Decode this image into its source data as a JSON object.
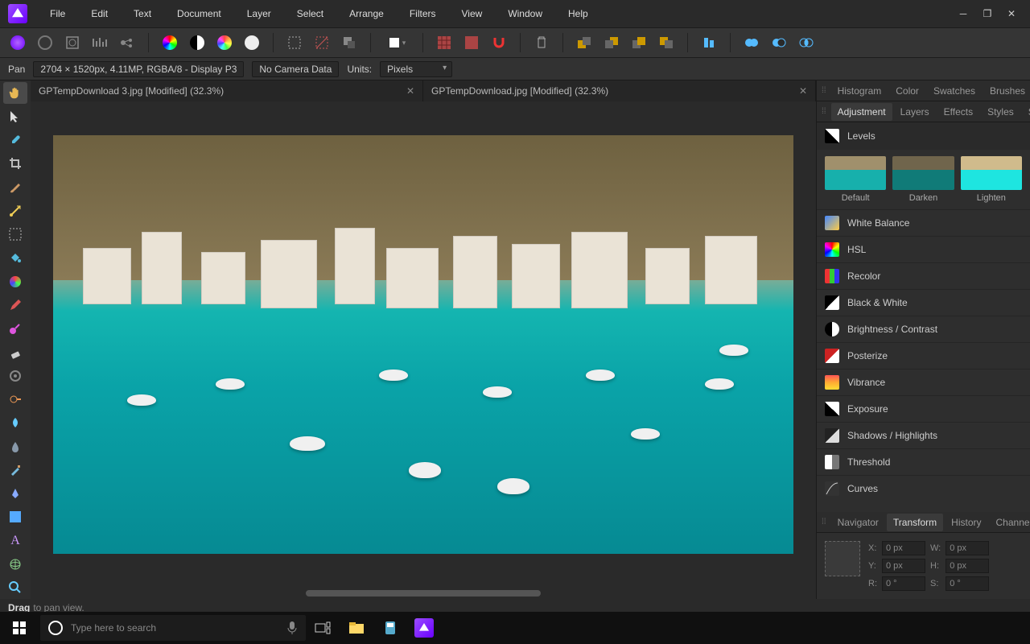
{
  "menu": {
    "items": [
      "File",
      "Edit",
      "Text",
      "Document",
      "Layer",
      "Select",
      "Arrange",
      "Filters",
      "View",
      "Window",
      "Help"
    ]
  },
  "context": {
    "tool": "Pan",
    "info": "2704 × 1520px, 4.11MP, RGBA/8 - Display P3",
    "camera": "No Camera Data",
    "units_label": "Units:",
    "units_value": "Pixels"
  },
  "tabs": [
    {
      "label": "GPTempDownload 3.jpg [Modified] (32.3%)"
    },
    {
      "label": "GPTempDownload.jpg [Modified] (32.3%)"
    }
  ],
  "panel_tabs_top": [
    "Histogram",
    "Color",
    "Swatches",
    "Brushes"
  ],
  "panel_tabs_mid": {
    "items": [
      "Adjustment",
      "Layers",
      "Effects",
      "Styles",
      "Stock"
    ],
    "active": 0
  },
  "levels": {
    "label": "Levels"
  },
  "presets": [
    {
      "label": "Default"
    },
    {
      "label": "Darken"
    },
    {
      "label": "Lighten"
    }
  ],
  "adjustments": [
    "White Balance",
    "HSL",
    "Recolor",
    "Black & White",
    "Brightness / Contrast",
    "Posterize",
    "Vibrance",
    "Exposure",
    "Shadows / Highlights",
    "Threshold",
    "Curves"
  ],
  "panel_tabs_bot": {
    "items": [
      "Navigator",
      "Transform",
      "History",
      "Channels"
    ],
    "active": 1
  },
  "transform": {
    "x_label": "X:",
    "x": "0 px",
    "y_label": "Y:",
    "y": "0 px",
    "w_label": "W:",
    "w": "0 px",
    "h_label": "H:",
    "h": "0 px",
    "r_label": "R:",
    "r": "0 °",
    "s_label": "S:",
    "s": "0 °"
  },
  "status": {
    "bold": "Drag",
    "rest": "to pan view."
  },
  "taskbar": {
    "search_placeholder": "Type here to search"
  }
}
